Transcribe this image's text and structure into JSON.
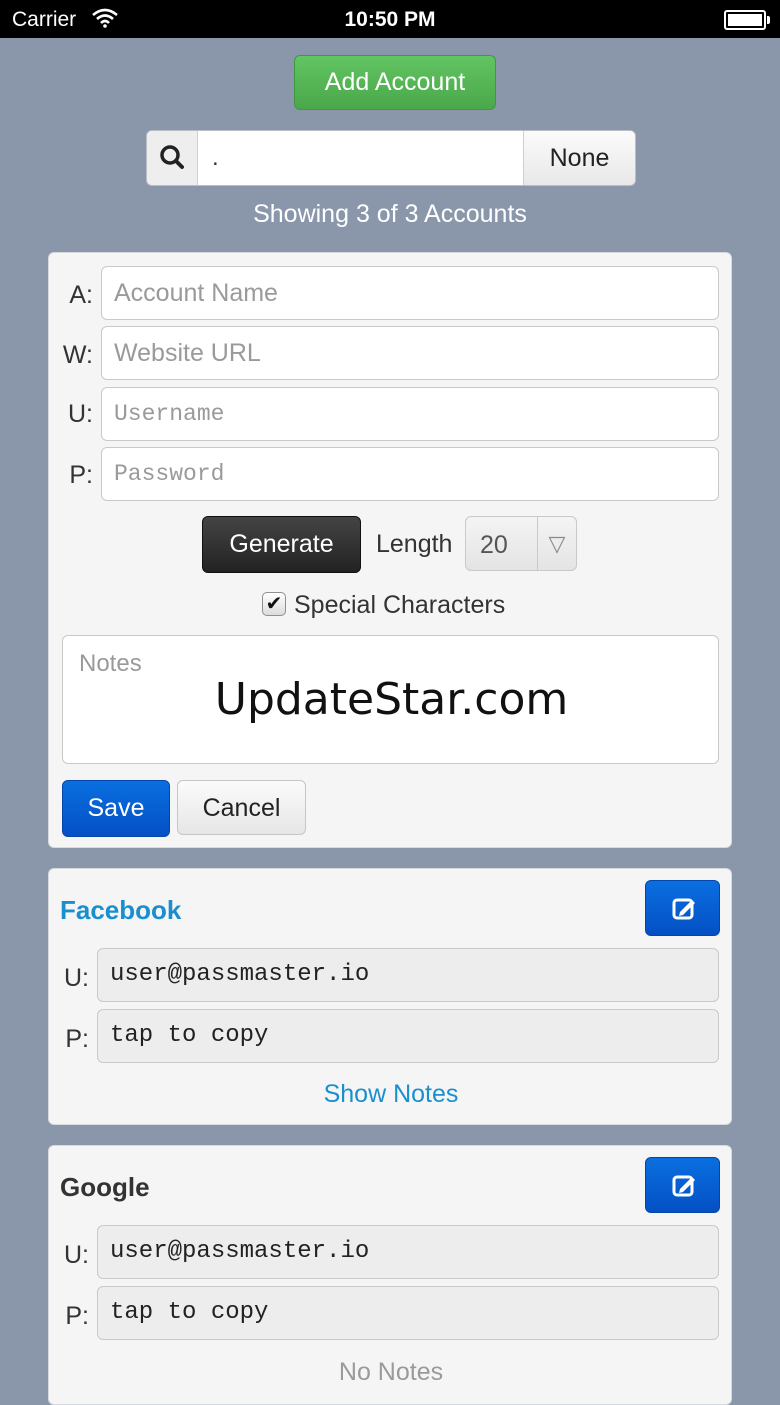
{
  "status_bar": {
    "carrier": "Carrier",
    "time": "10:50 PM"
  },
  "add_account_label": "Add Account",
  "search": {
    "value": ".",
    "none_label": "None"
  },
  "showing_text": "Showing 3 of 3 Accounts",
  "form": {
    "account_label": "A:",
    "account_placeholder": "Account Name",
    "website_label": "W:",
    "website_placeholder": "Website URL",
    "username_label": "U:",
    "username_placeholder": "Username",
    "password_label": "P:",
    "password_placeholder": "Password",
    "generate_label": "Generate",
    "length_label": "Length",
    "length_value": "20",
    "special_label": "Special Characters",
    "special_checked": true,
    "notes_placeholder": "Notes",
    "watermark": "UpdateStar.com",
    "save_label": "Save",
    "cancel_label": "Cancel"
  },
  "accounts": [
    {
      "name": "Facebook",
      "name_color": "#1a8fd0",
      "u_label": "U:",
      "username": "user@passmaster.io",
      "p_label": "P:",
      "password_hint": "tap to copy",
      "notes_link": "Show Notes",
      "notes_color": "#1a8fd0"
    },
    {
      "name": "Google",
      "name_color": "#333333",
      "u_label": "U:",
      "username": "user@passmaster.io",
      "p_label": "P:",
      "password_hint": "tap to copy",
      "notes_link": "No Notes",
      "notes_color": "#9a9a9a"
    }
  ]
}
